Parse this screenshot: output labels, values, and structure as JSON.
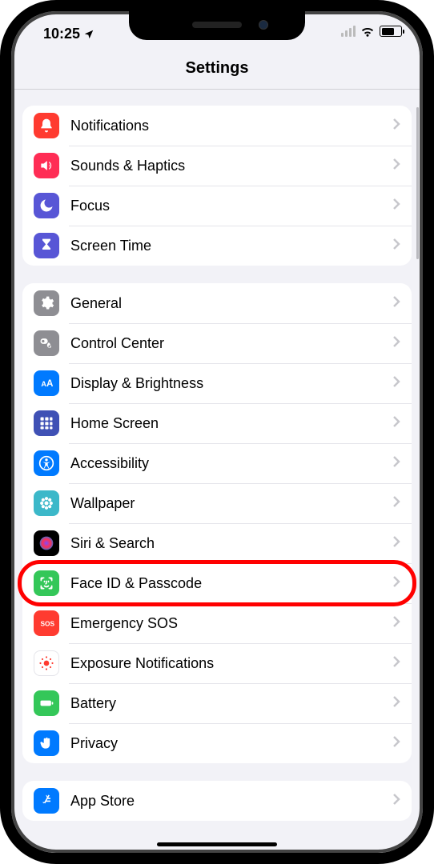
{
  "statusbar": {
    "time": "10:25"
  },
  "nav": {
    "title": "Settings"
  },
  "groups": [
    {
      "rows": [
        {
          "key": "notifications",
          "label": "Notifications",
          "icon": "bell-icon",
          "color": "#ff3b30"
        },
        {
          "key": "sounds",
          "label": "Sounds & Haptics",
          "icon": "speaker-icon",
          "color": "#ff2d55"
        },
        {
          "key": "focus",
          "label": "Focus",
          "icon": "moon-icon",
          "color": "#5856d6"
        },
        {
          "key": "screentime",
          "label": "Screen Time",
          "icon": "hourglass-icon",
          "color": "#5856d6"
        }
      ]
    },
    {
      "rows": [
        {
          "key": "general",
          "label": "General",
          "icon": "gear-icon",
          "color": "#8e8e93"
        },
        {
          "key": "controlcenter",
          "label": "Control Center",
          "icon": "switches-icon",
          "color": "#8e8e93"
        },
        {
          "key": "display",
          "label": "Display & Brightness",
          "icon": "aa-icon",
          "color": "#007aff"
        },
        {
          "key": "homescreen",
          "label": "Home Screen",
          "icon": "apps-icon",
          "color": "#3f51b5"
        },
        {
          "key": "accessibility",
          "label": "Accessibility",
          "icon": "accessibility-icon",
          "color": "#007aff"
        },
        {
          "key": "wallpaper",
          "label": "Wallpaper",
          "icon": "flower-icon",
          "color": "#3cb8c9"
        },
        {
          "key": "siri",
          "label": "Siri & Search",
          "icon": "siri-icon",
          "color": "#000"
        },
        {
          "key": "faceid",
          "label": "Face ID & Passcode",
          "icon": "faceid-icon",
          "color": "#34c759",
          "highlighted": true
        },
        {
          "key": "sos",
          "label": "Emergency SOS",
          "icon": "sos-icon",
          "color": "#ff3b30"
        },
        {
          "key": "exposure",
          "label": "Exposure Notifications",
          "icon": "exposure-icon",
          "color": "#fff"
        },
        {
          "key": "battery",
          "label": "Battery",
          "icon": "battery-icon",
          "color": "#34c759"
        },
        {
          "key": "privacy",
          "label": "Privacy",
          "icon": "hand-icon",
          "color": "#007aff"
        }
      ]
    },
    {
      "rows": [
        {
          "key": "appstore",
          "label": "App Store",
          "icon": "appstore-icon",
          "color": "#007aff"
        }
      ]
    }
  ]
}
